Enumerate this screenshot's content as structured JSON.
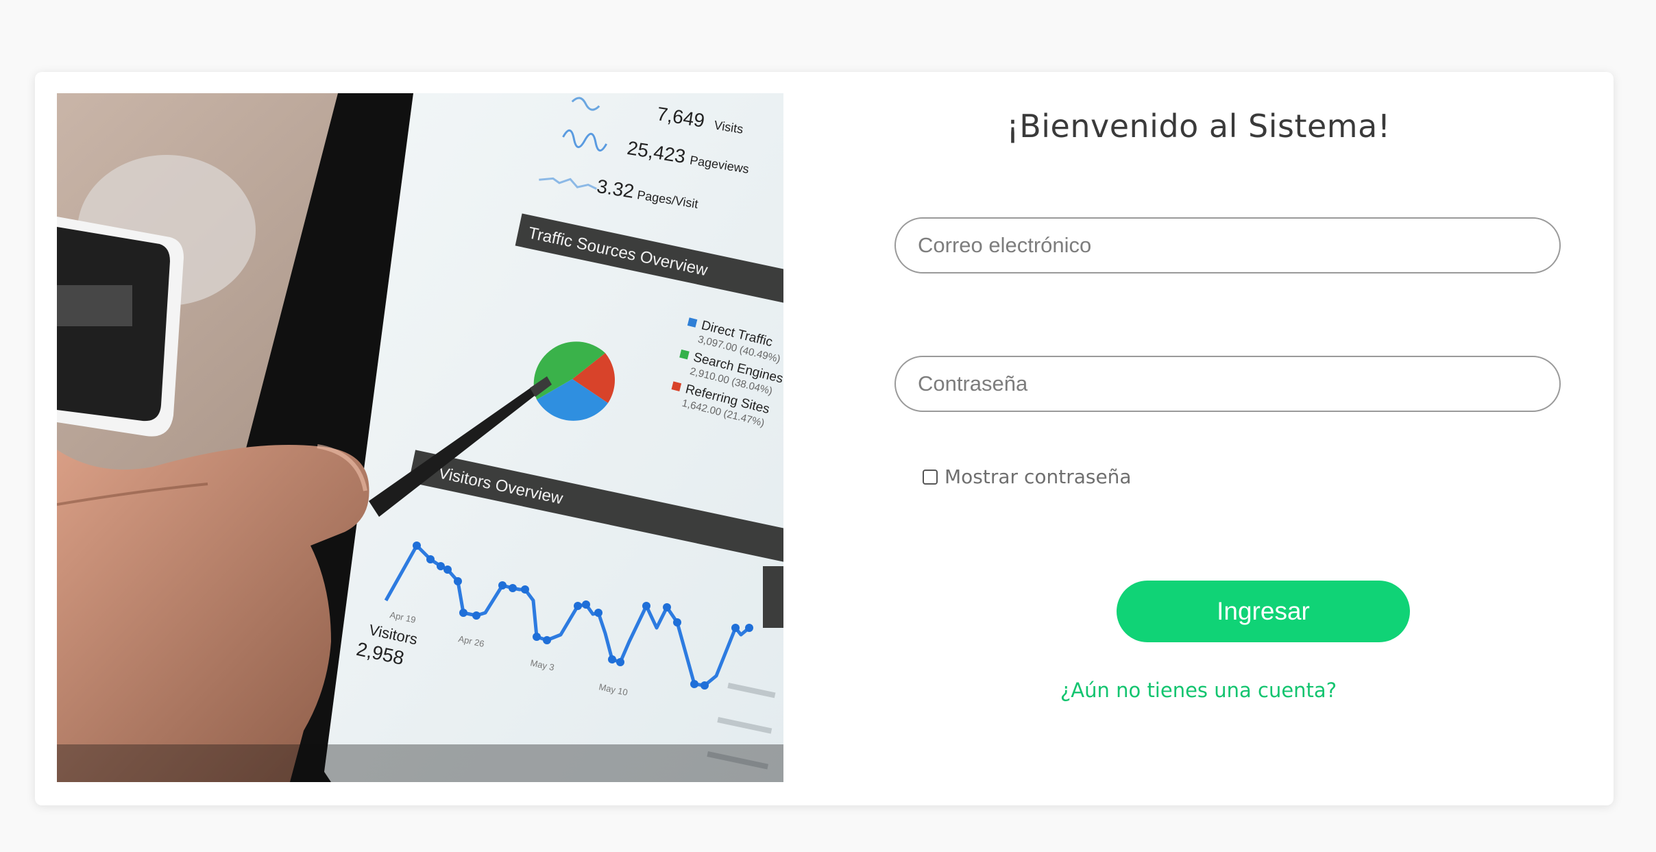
{
  "login": {
    "title": "¡Bienvenido al Sistema!",
    "email_placeholder": "Correo electrónico",
    "password_placeholder": "Contraseña",
    "show_password_label": "Mostrar contraseña",
    "submit_label": "Ingresar",
    "register_link": "¿Aún no tienes una cuenta?"
  },
  "photo": {
    "metrics": [
      {
        "value": "7,649",
        "label": "Visits"
      },
      {
        "value": "25,423",
        "label": "Pageviews"
      },
      {
        "value": "3.32",
        "label": "Pages/Visit"
      }
    ],
    "traffic_header": "Traffic Sources Overview",
    "legend": [
      {
        "label": "Direct Traffic",
        "detail": "3,097.00 (40.49%)",
        "color": "#2f7fd6"
      },
      {
        "label": "Search Engines",
        "detail": "2,910.00 (38.04%)",
        "color": "#34b14a"
      },
      {
        "label": "Referring Sites",
        "detail": "1,642.00 (21.47%)",
        "color": "#d8432a"
      }
    ],
    "visitors_header": "Visitors Overview",
    "visitors_label": "Visitors",
    "visitors_value": "2,958",
    "x_ticks": [
      "Apr 19",
      "Apr 26",
      "May 3",
      "May 10"
    ]
  },
  "colors": {
    "accent": "#10d376",
    "link": "#13c46f",
    "border": "#9a9a9a",
    "background": "#f9f9f9"
  }
}
